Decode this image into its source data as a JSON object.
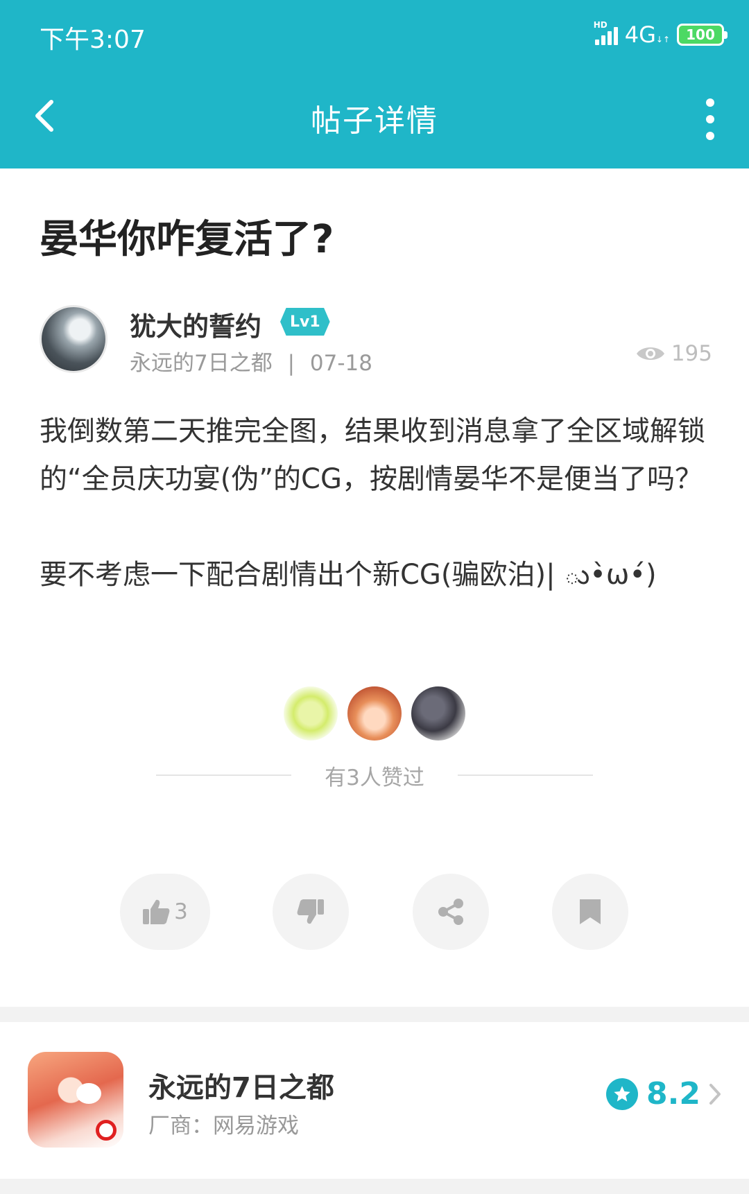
{
  "status_bar": {
    "time": "下午3:07",
    "network_hd": "HD",
    "network": "4G",
    "battery": "100"
  },
  "nav": {
    "title": "帖子详情",
    "back_icon": "chevron-left-icon",
    "more_icon": "more-vertical-icon"
  },
  "post": {
    "title": "晏华你咋复活了?",
    "author": {
      "name": "犹大的誓约",
      "level": "Lv1",
      "game": "永远的7日之都",
      "separator": "|",
      "date": "07-18"
    },
    "views": "195",
    "paragraphs": [
      "我倒数第二天推完全图，结果收到消息拿了全区域解锁的“全员庆功宴(伪”的CG，按剧情晏华不是便当了吗？",
      "要不考虑一下配合剧情出个新CG(骗欧泊)| ు•̀ω•́)"
    ]
  },
  "likes": {
    "text": "有3人赞过",
    "avatars": [
      "liker-avatar-lemon",
      "liker-avatar-girl",
      "liker-avatar-dark"
    ]
  },
  "actions": {
    "like_count": "3",
    "icons": [
      "thumbs-up-icon",
      "thumbs-down-icon",
      "share-icon",
      "bookmark-icon"
    ]
  },
  "game_card": {
    "name": "永远的7日之都",
    "vendor": "厂商：网易游戏",
    "rating": "8.2"
  },
  "colors": {
    "accent": "#1fb6c8",
    "level_badge": "#2fbfc9"
  }
}
